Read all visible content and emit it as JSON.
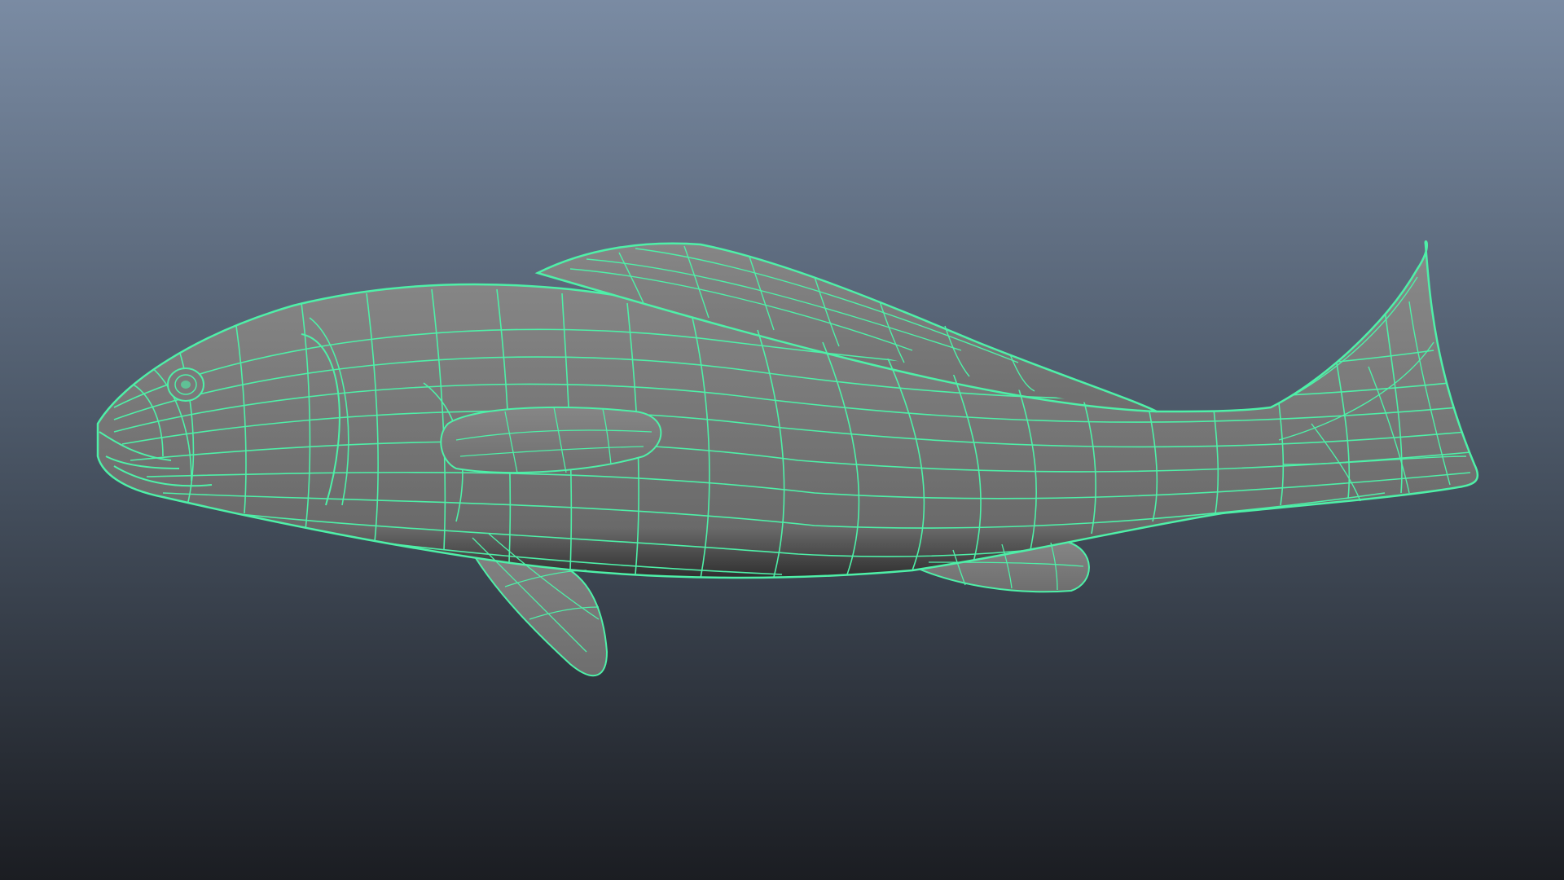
{
  "viewport": {
    "background_top": "#7a8ba3",
    "background_mid": "#4c5868",
    "background_bottom": "#1b1d22"
  },
  "model": {
    "subject": "fish",
    "shading_color": "#7a7a7a",
    "shadow_color": "#2f2f2f",
    "wireframe_color": "#4ef0a8"
  }
}
